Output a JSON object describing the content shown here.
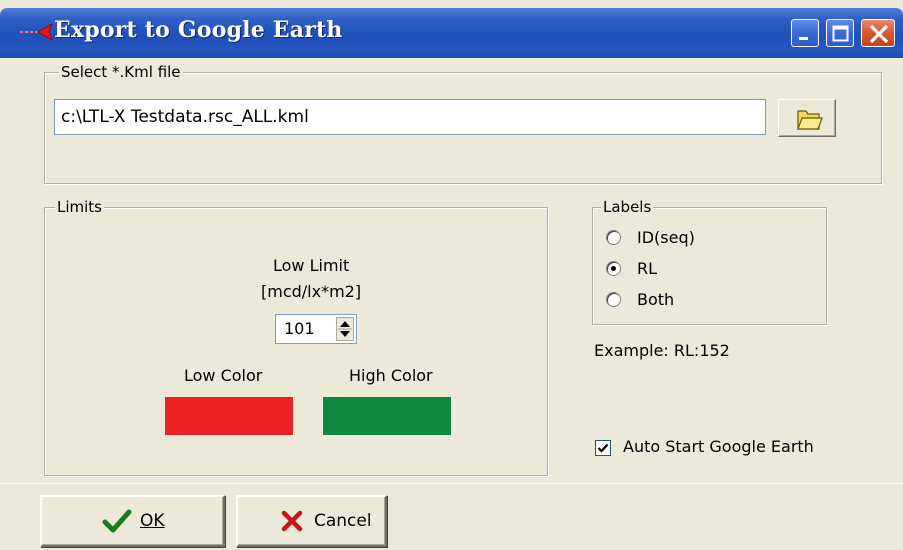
{
  "window": {
    "title": "Export to Google Earth"
  },
  "titlebar_buttons": {
    "minimize": "minimize-icon",
    "maximize": "maximize-icon",
    "close": "close-icon"
  },
  "file_group": {
    "legend": "Select *.Kml file",
    "path": "c:\\LTL-X Testdata.rsc_ALL.kml",
    "browse_icon": "folder-icon"
  },
  "limits": {
    "legend": "Limits",
    "low_limit_label": "Low Limit",
    "unit_label": "[mcd/lx*m2]",
    "low_limit_value": "101",
    "low_color_label": "Low Color",
    "high_color_label": "High Color",
    "low_color": "#ec2224",
    "high_color": "#0e8a3e"
  },
  "labels": {
    "legend": "Labels",
    "options": [
      "ID(seq)",
      "RL",
      "Both"
    ],
    "selected": "RL"
  },
  "example_text": "Example: RL:152",
  "auto_start": {
    "label": "Auto Start Google Earth",
    "checked": true
  },
  "buttons": {
    "ok": "OK",
    "cancel": "Cancel"
  }
}
